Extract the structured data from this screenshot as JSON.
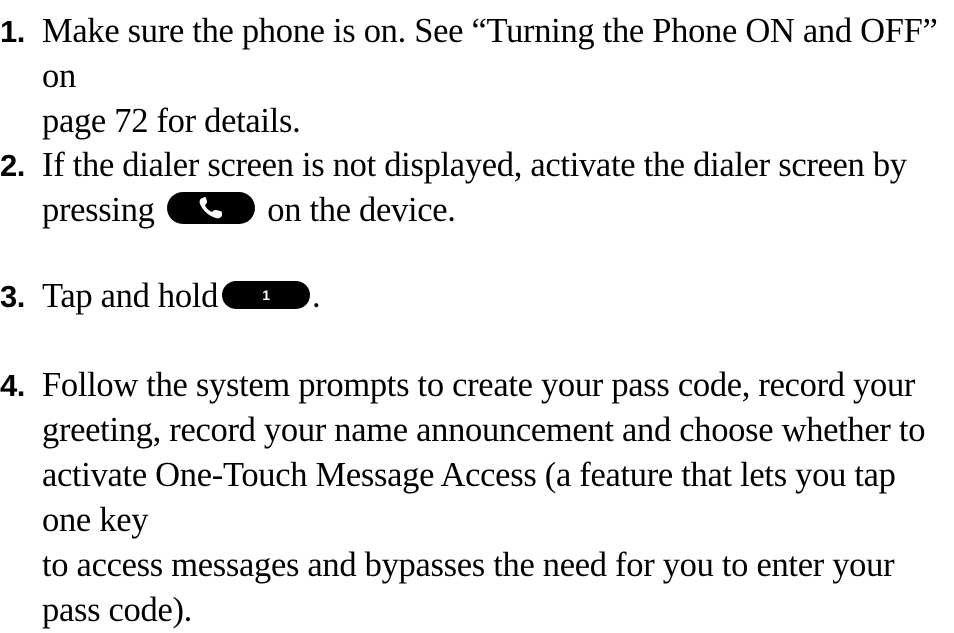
{
  "steps": [
    {
      "number": "1.",
      "line1": "Make sure the phone is on. See “Turning the Phone ON and OFF” on",
      "line2": "page 72 for details."
    },
    {
      "number": "2.",
      "line1": "If the dialer screen is not displayed, activate the dialer screen by",
      "line2_before": "pressing",
      "line2_after": "on the device.",
      "icon": "phone-talk-key-icon"
    },
    {
      "number": "3.",
      "line1_before": "Tap and hold",
      "line1_after": ".",
      "key_label": "1",
      "icon": "key-1-icon"
    },
    {
      "number": "4.",
      "line1": "Follow the system prompts to create your pass code, record your",
      "line2": "greeting, record your name announcement and choose whether to",
      "line3": "activate One-Touch Message Access (a feature that lets you tap one key",
      "line4": "to access messages and bypasses the need for you to enter your",
      "line5": "pass code)."
    }
  ]
}
